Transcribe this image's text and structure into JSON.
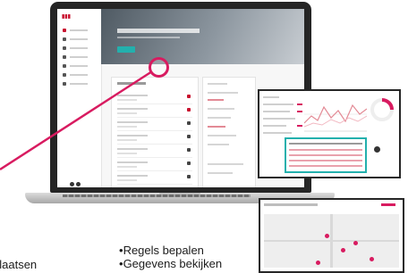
{
  "bullets": [
    "Regels bepalen",
    "Gegevens bekijken"
  ],
  "cut_text": "plaatsen",
  "colors": {
    "accent": "#d81b60",
    "brand_red": "#c8102e",
    "teal": "#23b0ad",
    "laptop": "#252525"
  },
  "icons": [
    "cursor-highlight-icon",
    "menu-icon",
    "map-pin-icon"
  ]
}
